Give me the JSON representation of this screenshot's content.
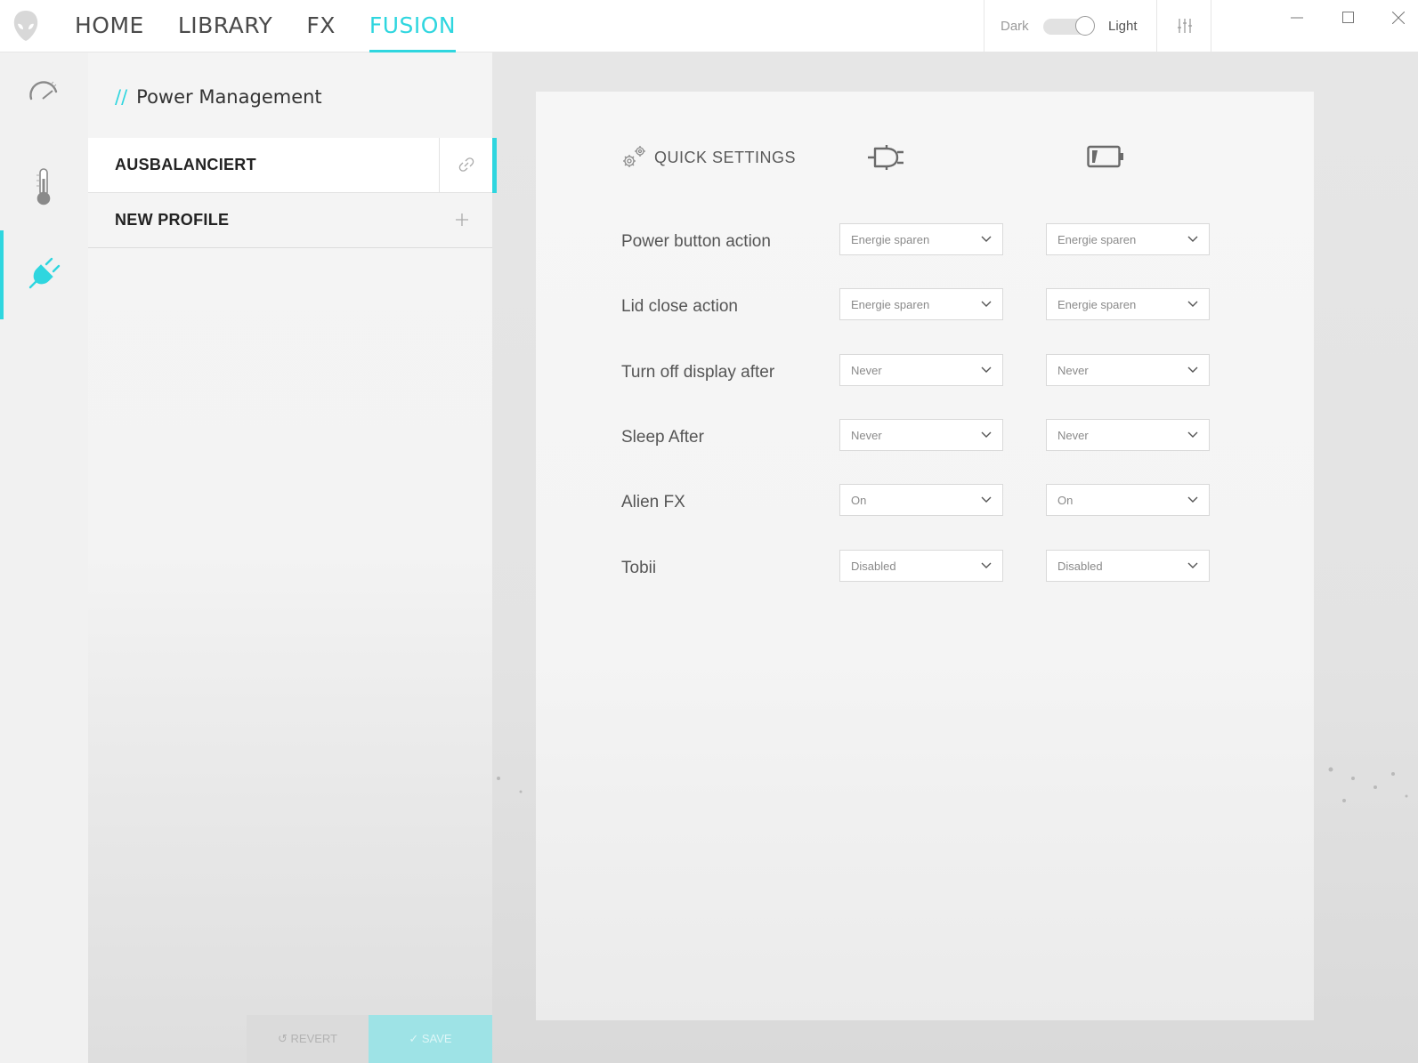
{
  "nav": {
    "tabs": [
      {
        "label": "HOME"
      },
      {
        "label": "LIBRARY"
      },
      {
        "label": "FX"
      },
      {
        "label": "FUSION"
      }
    ],
    "active_tab": "FUSION"
  },
  "theme": {
    "dark_label": "Dark",
    "light_label": "Light",
    "selected": "Light"
  },
  "icons": {
    "logo": "alien-head-icon",
    "settings": "sliders-icon",
    "rail": [
      "speedometer-icon",
      "thermometer-icon",
      "plug-icon"
    ],
    "ac_column": "power-plug-icon",
    "battery_column": "battery-icon",
    "link": "link-icon",
    "add": "plus-icon",
    "quick_settings": "gears-icon"
  },
  "colors": {
    "accent": "#2fd6df"
  },
  "panel": {
    "title_prefix": "//",
    "title": "Power Management",
    "profiles": [
      {
        "name": "AUSBALANCIERT",
        "active": true
      },
      {
        "name": "NEW PROFILE",
        "active": false
      }
    ],
    "revert_label": "↺ REVERT",
    "save_label": "✓ SAVE"
  },
  "quick_settings": {
    "title": "QUICK SETTINGS",
    "rows": [
      {
        "label": "Power button action",
        "ac": "Energie sparen",
        "battery": "Energie sparen"
      },
      {
        "label": "Lid close action",
        "ac": "Energie sparen",
        "battery": "Energie sparen"
      },
      {
        "label": "Turn off display after",
        "ac": "Never",
        "battery": "Never"
      },
      {
        "label": "Sleep After",
        "ac": "Never",
        "battery": "Never"
      },
      {
        "label": "Alien FX",
        "ac": "On",
        "battery": "On"
      },
      {
        "label": "Tobii",
        "ac": "Disabled",
        "battery": "Disabled"
      }
    ]
  }
}
